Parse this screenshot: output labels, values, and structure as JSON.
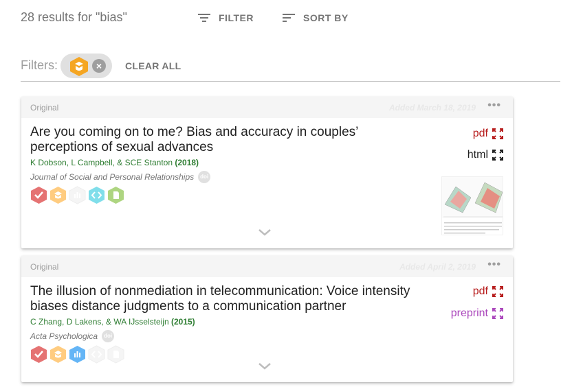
{
  "search": {
    "results_text": "28 results for \"bias\"",
    "filter_label": "FILTER",
    "sort_label": "SORT BY"
  },
  "filters": {
    "label": "Filters:",
    "active_chip_icon": "open-materials-icon",
    "clear_all_label": "CLEAR ALL"
  },
  "results": [
    {
      "type": "Original",
      "added": "Added March 18, 2019",
      "more_label": "•••",
      "title": "Are you coming on to me? Bias and accuracy in couples’ perceptions of sexual advances",
      "authors": "K Dobson, L Campbell, & SCE Stanton",
      "year": "(2018)",
      "journal": "Journal of Social and Personal Relationships",
      "doi_label": "doi",
      "links": [
        {
          "label": "pdf",
          "color": "#b71c1c"
        },
        {
          "label": "html",
          "color": "#212121"
        }
      ],
      "badges": [
        "preregistered-icon",
        "materials-icon",
        "data-icon",
        "code-icon",
        "supplement-icon"
      ]
    },
    {
      "type": "Original",
      "added": "Added April 2, 2019",
      "more_label": "•••",
      "title": "The illusion of nonmediation in telecommunication: Voice intensity biases distance judgments to a communication partner",
      "authors": "C Zhang, D Lakens, & WA IJsselsteijn",
      "year": "(2015)",
      "journal": "Acta Psychologica",
      "doi_label": "doi",
      "links": [
        {
          "label": "pdf",
          "color": "#b71c1c"
        },
        {
          "label": "preprint",
          "color": "#ab47bc"
        }
      ],
      "badges": [
        "preregistered-icon",
        "materials-icon",
        "data-icon",
        "code-icon",
        "supplement-icon"
      ]
    }
  ],
  "colors": {
    "accent_orange": "#f5a623",
    "badge_red": "#e57373",
    "badge_orange": "#ffcc80",
    "badge_blue": "#64b5f6",
    "badge_teal": "#80deea",
    "badge_green": "#aed581",
    "badge_gray": "#eeeeee"
  }
}
